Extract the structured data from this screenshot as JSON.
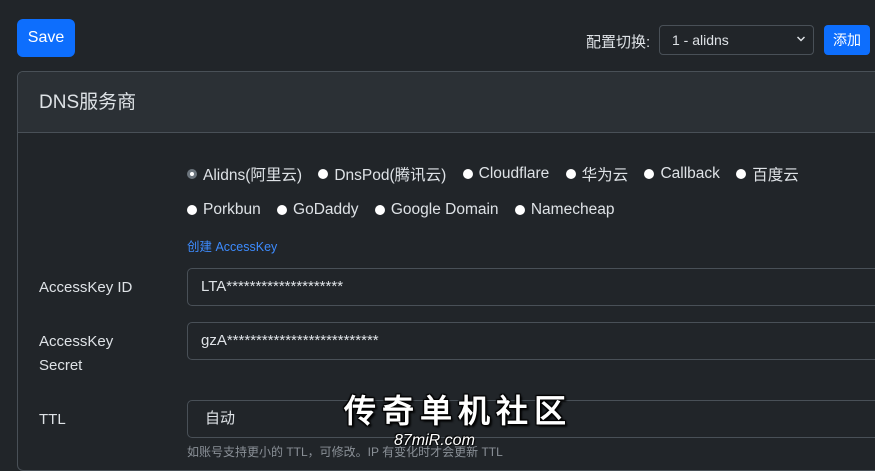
{
  "toolbar": {
    "save_label": "Save",
    "config_label": "配置切换:",
    "config_selected": "1 - alidns",
    "add_label": "添加"
  },
  "card": {
    "title": "DNS服务商"
  },
  "providers": {
    "row1": [
      {
        "label": "Alidns(阿里云)",
        "checked": true
      },
      {
        "label": "DnsPod(腾讯云)",
        "checked": false
      },
      {
        "label": "Cloudflare",
        "checked": false
      },
      {
        "label": "华为云",
        "checked": false
      },
      {
        "label": "Callback",
        "checked": false
      },
      {
        "label": "百度云",
        "checked": false
      }
    ],
    "row2": [
      {
        "label": "Porkbun",
        "checked": false
      },
      {
        "label": "GoDaddy",
        "checked": false
      },
      {
        "label": "Google Domain",
        "checked": false
      },
      {
        "label": "Namecheap",
        "checked": false
      }
    ],
    "create_link": "创建 AccessKey"
  },
  "fields": {
    "access_key_id_label": "AccessKey ID",
    "access_key_id_value": "LTA********************",
    "access_key_secret_label_1": "AccessKey",
    "access_key_secret_label_2": "Secret",
    "access_key_secret_value": "gzA**************************",
    "ttl_label": "TTL",
    "ttl_value": "自动",
    "ttl_help": "如账号支持更小的 TTL，可修改。IP 有变化时才会更新 TTL"
  },
  "watermark": {
    "title": "传奇单机社区",
    "url": "87miR.com"
  }
}
